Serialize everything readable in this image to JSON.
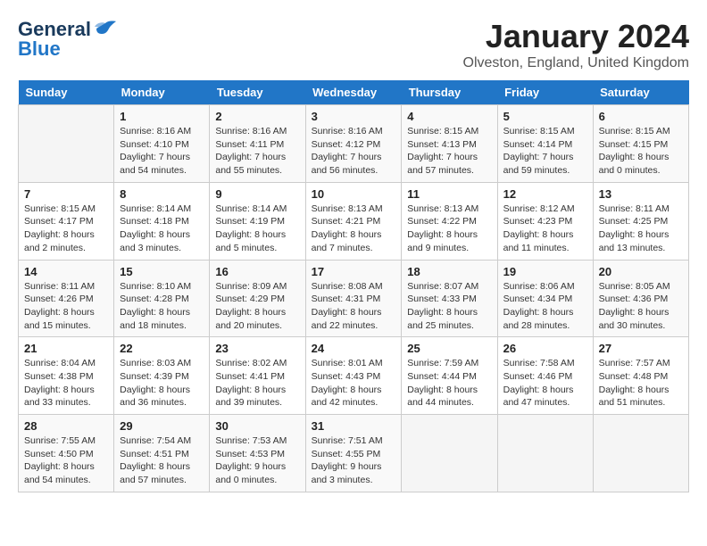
{
  "logo": {
    "general": "General",
    "blue": "Blue"
  },
  "header": {
    "month": "January 2024",
    "location": "Olveston, England, United Kingdom"
  },
  "weekdays": [
    "Sunday",
    "Monday",
    "Tuesday",
    "Wednesday",
    "Thursday",
    "Friday",
    "Saturday"
  ],
  "weeks": [
    [
      {
        "day": "",
        "sunrise": "",
        "sunset": "",
        "daylight": ""
      },
      {
        "day": "1",
        "sunrise": "Sunrise: 8:16 AM",
        "sunset": "Sunset: 4:10 PM",
        "daylight": "Daylight: 7 hours and 54 minutes."
      },
      {
        "day": "2",
        "sunrise": "Sunrise: 8:16 AM",
        "sunset": "Sunset: 4:11 PM",
        "daylight": "Daylight: 7 hours and 55 minutes."
      },
      {
        "day": "3",
        "sunrise": "Sunrise: 8:16 AM",
        "sunset": "Sunset: 4:12 PM",
        "daylight": "Daylight: 7 hours and 56 minutes."
      },
      {
        "day": "4",
        "sunrise": "Sunrise: 8:15 AM",
        "sunset": "Sunset: 4:13 PM",
        "daylight": "Daylight: 7 hours and 57 minutes."
      },
      {
        "day": "5",
        "sunrise": "Sunrise: 8:15 AM",
        "sunset": "Sunset: 4:14 PM",
        "daylight": "Daylight: 7 hours and 59 minutes."
      },
      {
        "day": "6",
        "sunrise": "Sunrise: 8:15 AM",
        "sunset": "Sunset: 4:15 PM",
        "daylight": "Daylight: 8 hours and 0 minutes."
      }
    ],
    [
      {
        "day": "7",
        "sunrise": "Sunrise: 8:15 AM",
        "sunset": "Sunset: 4:17 PM",
        "daylight": "Daylight: 8 hours and 2 minutes."
      },
      {
        "day": "8",
        "sunrise": "Sunrise: 8:14 AM",
        "sunset": "Sunset: 4:18 PM",
        "daylight": "Daylight: 8 hours and 3 minutes."
      },
      {
        "day": "9",
        "sunrise": "Sunrise: 8:14 AM",
        "sunset": "Sunset: 4:19 PM",
        "daylight": "Daylight: 8 hours and 5 minutes."
      },
      {
        "day": "10",
        "sunrise": "Sunrise: 8:13 AM",
        "sunset": "Sunset: 4:21 PM",
        "daylight": "Daylight: 8 hours and 7 minutes."
      },
      {
        "day": "11",
        "sunrise": "Sunrise: 8:13 AM",
        "sunset": "Sunset: 4:22 PM",
        "daylight": "Daylight: 8 hours and 9 minutes."
      },
      {
        "day": "12",
        "sunrise": "Sunrise: 8:12 AM",
        "sunset": "Sunset: 4:23 PM",
        "daylight": "Daylight: 8 hours and 11 minutes."
      },
      {
        "day": "13",
        "sunrise": "Sunrise: 8:11 AM",
        "sunset": "Sunset: 4:25 PM",
        "daylight": "Daylight: 8 hours and 13 minutes."
      }
    ],
    [
      {
        "day": "14",
        "sunrise": "Sunrise: 8:11 AM",
        "sunset": "Sunset: 4:26 PM",
        "daylight": "Daylight: 8 hours and 15 minutes."
      },
      {
        "day": "15",
        "sunrise": "Sunrise: 8:10 AM",
        "sunset": "Sunset: 4:28 PM",
        "daylight": "Daylight: 8 hours and 18 minutes."
      },
      {
        "day": "16",
        "sunrise": "Sunrise: 8:09 AM",
        "sunset": "Sunset: 4:29 PM",
        "daylight": "Daylight: 8 hours and 20 minutes."
      },
      {
        "day": "17",
        "sunrise": "Sunrise: 8:08 AM",
        "sunset": "Sunset: 4:31 PM",
        "daylight": "Daylight: 8 hours and 22 minutes."
      },
      {
        "day": "18",
        "sunrise": "Sunrise: 8:07 AM",
        "sunset": "Sunset: 4:33 PM",
        "daylight": "Daylight: 8 hours and 25 minutes."
      },
      {
        "day": "19",
        "sunrise": "Sunrise: 8:06 AM",
        "sunset": "Sunset: 4:34 PM",
        "daylight": "Daylight: 8 hours and 28 minutes."
      },
      {
        "day": "20",
        "sunrise": "Sunrise: 8:05 AM",
        "sunset": "Sunset: 4:36 PM",
        "daylight": "Daylight: 8 hours and 30 minutes."
      }
    ],
    [
      {
        "day": "21",
        "sunrise": "Sunrise: 8:04 AM",
        "sunset": "Sunset: 4:38 PM",
        "daylight": "Daylight: 8 hours and 33 minutes."
      },
      {
        "day": "22",
        "sunrise": "Sunrise: 8:03 AM",
        "sunset": "Sunset: 4:39 PM",
        "daylight": "Daylight: 8 hours and 36 minutes."
      },
      {
        "day": "23",
        "sunrise": "Sunrise: 8:02 AM",
        "sunset": "Sunset: 4:41 PM",
        "daylight": "Daylight: 8 hours and 39 minutes."
      },
      {
        "day": "24",
        "sunrise": "Sunrise: 8:01 AM",
        "sunset": "Sunset: 4:43 PM",
        "daylight": "Daylight: 8 hours and 42 minutes."
      },
      {
        "day": "25",
        "sunrise": "Sunrise: 7:59 AM",
        "sunset": "Sunset: 4:44 PM",
        "daylight": "Daylight: 8 hours and 44 minutes."
      },
      {
        "day": "26",
        "sunrise": "Sunrise: 7:58 AM",
        "sunset": "Sunset: 4:46 PM",
        "daylight": "Daylight: 8 hours and 47 minutes."
      },
      {
        "day": "27",
        "sunrise": "Sunrise: 7:57 AM",
        "sunset": "Sunset: 4:48 PM",
        "daylight": "Daylight: 8 hours and 51 minutes."
      }
    ],
    [
      {
        "day": "28",
        "sunrise": "Sunrise: 7:55 AM",
        "sunset": "Sunset: 4:50 PM",
        "daylight": "Daylight: 8 hours and 54 minutes."
      },
      {
        "day": "29",
        "sunrise": "Sunrise: 7:54 AM",
        "sunset": "Sunset: 4:51 PM",
        "daylight": "Daylight: 8 hours and 57 minutes."
      },
      {
        "day": "30",
        "sunrise": "Sunrise: 7:53 AM",
        "sunset": "Sunset: 4:53 PM",
        "daylight": "Daylight: 9 hours and 0 minutes."
      },
      {
        "day": "31",
        "sunrise": "Sunrise: 7:51 AM",
        "sunset": "Sunset: 4:55 PM",
        "daylight": "Daylight: 9 hours and 3 minutes."
      },
      {
        "day": "",
        "sunrise": "",
        "sunset": "",
        "daylight": ""
      },
      {
        "day": "",
        "sunrise": "",
        "sunset": "",
        "daylight": ""
      },
      {
        "day": "",
        "sunrise": "",
        "sunset": "",
        "daylight": ""
      }
    ]
  ]
}
